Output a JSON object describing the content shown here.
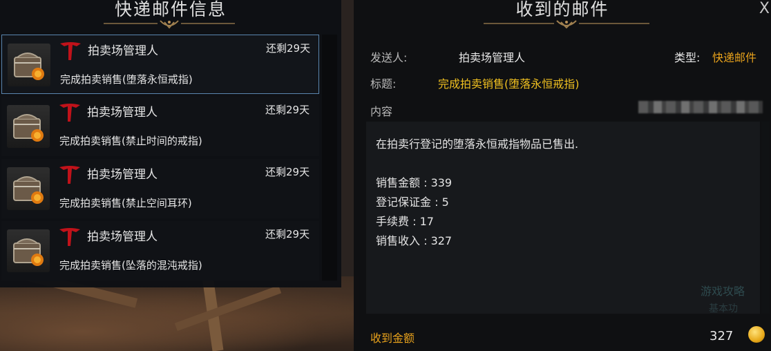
{
  "left_panel": {
    "title": "快递邮件信息",
    "mails": [
      {
        "sender": "拍卖场管理人",
        "remaining": "还剩29天",
        "subject": "完成拍卖销售(堕落永恒戒指)",
        "selected": true
      },
      {
        "sender": "拍卖场管理人",
        "remaining": "还剩29天",
        "subject": "完成拍卖销售(禁止时间的戒指)",
        "selected": false
      },
      {
        "sender": "拍卖场管理人",
        "remaining": "还剩29天",
        "subject": "完成拍卖销售(禁止空间耳环)",
        "selected": false
      },
      {
        "sender": "拍卖场管理人",
        "remaining": "还剩29天",
        "subject": "完成拍卖销售(坠落的混沌戒指)",
        "selected": false
      }
    ]
  },
  "right_panel": {
    "title": "收到的邮件",
    "close": "X",
    "sender_label": "发送人:",
    "sender_value": "拍卖场管理人",
    "type_label": "类型:",
    "type_value": "快递邮件",
    "subject_label": "标题:",
    "subject_value": "完成拍卖销售(堕落永恒戒指)",
    "content_label": "内容",
    "content_lines": [
      "在拍卖行登记的堕落永恒戒指物品已售出.",
      "销售金额 : 339",
      "登记保证金 : 5",
      "手续费 : 17",
      "销售收入 : 327"
    ],
    "watermark": [
      "游戏攻略",
      "基本功"
    ],
    "received_label": "收到金额",
    "received_amount": "327"
  },
  "colors": {
    "accent_gold": "#e8a21c",
    "title_yellow": "#f0c020",
    "selected_border": "#5a86b0",
    "logo_red": "#c0121a"
  },
  "icons": {
    "chest": "treasure-chest-icon",
    "logo": "sender-logo-icon",
    "coin": "gold-coin-icon",
    "close": "close-icon"
  }
}
